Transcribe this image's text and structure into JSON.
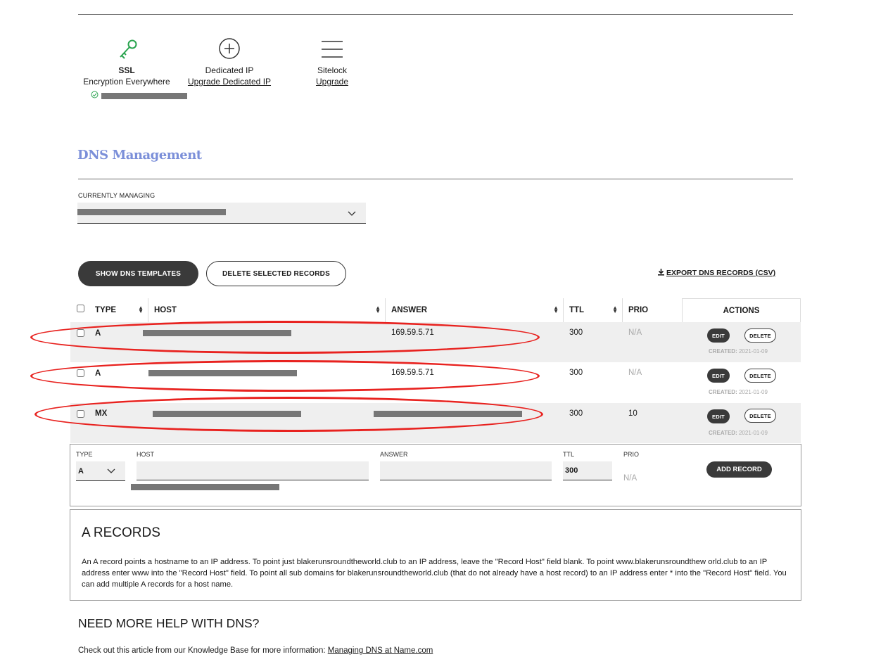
{
  "features": {
    "ssl": {
      "icon": "key-icon",
      "title": "SSL",
      "subtitle": "Encryption Everywhere"
    },
    "dedicated_ip": {
      "icon": "plus-circle-icon",
      "title": "Dedicated IP",
      "link": "Upgrade Dedicated IP"
    },
    "sitelock": {
      "icon": "menu-icon",
      "title": "Sitelock",
      "link": "Upgrade"
    }
  },
  "dns": {
    "title": "DNS Management",
    "currently_managing_label": "CURRENTLY MANAGING",
    "show_templates_label": "SHOW DNS TEMPLATES",
    "delete_selected_label": "DELETE SELECTED RECORDS",
    "export_label": "EXPORT DNS RECORDS (CSV)",
    "columns": {
      "type": "TYPE",
      "host": "HOST",
      "answer": "ANSWER",
      "ttl": "TTL",
      "prio": "PRIO",
      "actions": "ACTIONS"
    },
    "records": [
      {
        "type": "A",
        "answer": "169.59.5.71",
        "ttl": "300",
        "prio": "N/A",
        "edit": "EDIT",
        "delete": "DELETE",
        "created_label": "CREATED:",
        "created": "2021-01-09"
      },
      {
        "type": "A",
        "answer": "169.59.5.71",
        "ttl": "300",
        "prio": "N/A",
        "edit": "EDIT",
        "delete": "DELETE",
        "created_label": "CREATED:",
        "created": "2021-01-09"
      },
      {
        "type": "MX",
        "answer": "",
        "ttl": "300",
        "prio": "10",
        "edit": "EDIT",
        "delete": "DELETE",
        "created_label": "CREATED:",
        "created": "2021-01-09"
      }
    ],
    "add_form": {
      "type_label": "TYPE",
      "type_value": "A",
      "host_label": "HOST",
      "answer_label": "ANSWER",
      "ttl_label": "TTL",
      "ttl_value": "300",
      "prio_label": "PRIO",
      "prio_value": "N/A",
      "add_label": "ADD RECORD"
    },
    "info": {
      "title": "A RECORDS",
      "body": "An A record points a hostname to an IP address. To point just blakerunsroundtheworld.club to an IP address, leave the \"Record Host\" field blank. To point www.blakerunsroundthew orld.club to an IP address enter www into the \"Record Host\" field. To point all sub domains for blakerunsroundtheworld.club (that do not already have a host record) to an IP address enter * into the \"Record Host\" field. You can add multiple A records for a host name."
    },
    "help": {
      "title": "NEED MORE HELP WITH DNS?",
      "text": "Check out this article from our Knowledge Base for more information: ",
      "link": "Managing DNS at Name.com"
    }
  },
  "colors": {
    "accent_title": "#7b8fd9",
    "annotation_red": "#e8221f",
    "ssl_green": "#2aa44f"
  }
}
